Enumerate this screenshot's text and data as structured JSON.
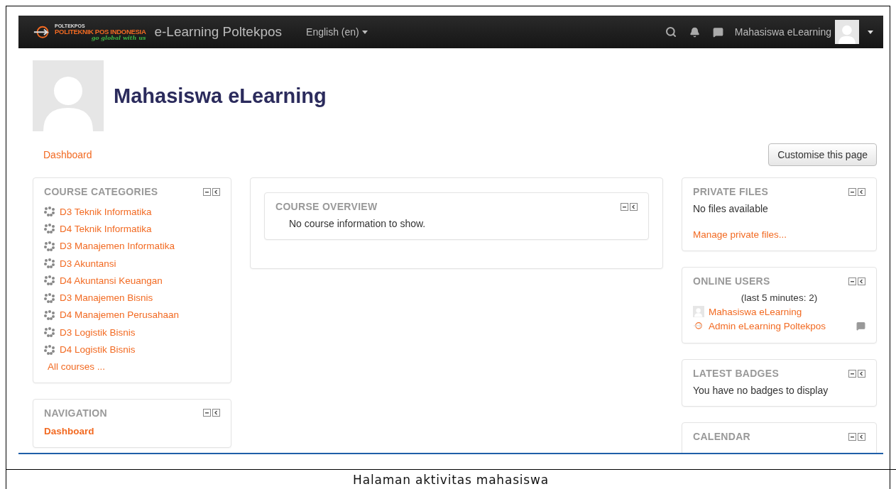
{
  "navbar": {
    "logo": {
      "top": "POLTEKPOS",
      "main": "POLITEKNIK POS INDONESIA",
      "tagline": "go global with us"
    },
    "site_name": "e-Learning Poltekpos",
    "language": "English (en)",
    "user_name": "Mahasiswa eLearning"
  },
  "profile": {
    "name": "Mahasiswa eLearning"
  },
  "breadcrumb": [
    "Dashboard"
  ],
  "customise_button": "Customise this page",
  "left_column": [
    {
      "kind": "categories",
      "title": "COURSE CATEGORIES",
      "items": [
        "D3 Teknik Informatika",
        "D4 Teknik Informatika",
        "D3 Manajemen Informatika",
        "D3 Akuntansi",
        "D4 Akuntansi Keuangan",
        "D3 Manajemen Bisnis",
        "D4 Manajemen Perusahaan",
        "D3 Logistik Bisnis",
        "D4 Logistik Bisnis"
      ],
      "footer_link": "All courses ..."
    },
    {
      "kind": "navigation",
      "title": "NAVIGATION",
      "items": [
        "Dashboard"
      ]
    }
  ],
  "main_column": [
    {
      "kind": "text",
      "title": "COURSE OVERVIEW",
      "message": "No course information to show."
    }
  ],
  "right_column": [
    {
      "kind": "files",
      "title": "PRIVATE FILES",
      "message": "No files available",
      "footer_link": "Manage private files..."
    },
    {
      "kind": "users",
      "title": "ONLINE USERS",
      "summary": "(last 5 minutes: 2)",
      "users": [
        {
          "name": "Mahasiswa eLearning",
          "kind": "avatar",
          "message_icon": false
        },
        {
          "name": "Admin eLearning Poltekpos",
          "kind": "logo",
          "message_icon": true
        }
      ]
    },
    {
      "kind": "text",
      "title": "LATEST BADGES",
      "message": "You have no badges to display"
    },
    {
      "kind": "text",
      "title": "CALENDAR"
    }
  ],
  "caption": "Halaman aktivitas mahasiswa"
}
